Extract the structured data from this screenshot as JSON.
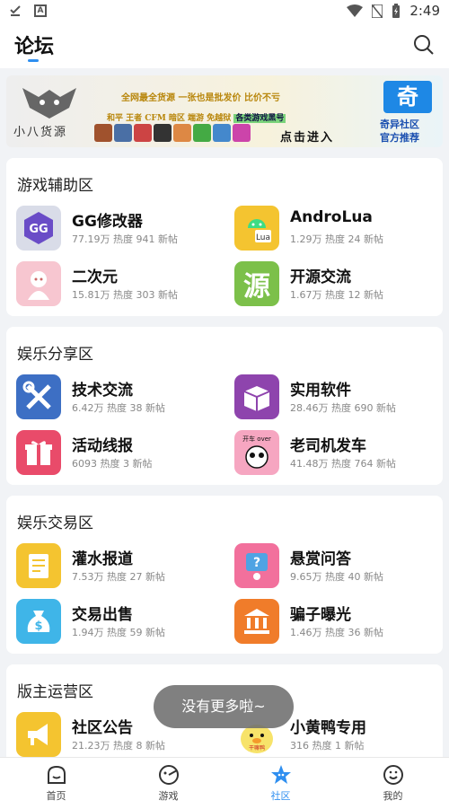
{
  "status_bar": {
    "time": "2:49"
  },
  "header": {
    "title": "论坛"
  },
  "banner": {
    "brand": "小八货源",
    "line1": "全网最全货源   一张也是批发价   比价不亏",
    "line2": "和平  王者  CFM  暗区  端游  免越狱",
    "tag": "各类游戏黑号",
    "cta": "点击进入",
    "logo_text": "奇",
    "community": "奇异社区",
    "recommend": "官方推荐"
  },
  "sections": [
    {
      "title": "游戏辅助区",
      "items": [
        {
          "name": "GG修改器",
          "stats": "77.19万 热度 941 新帖"
        },
        {
          "name": "AndroLua",
          "stats": "1.29万 热度 24 新帖"
        },
        {
          "name": "二次元",
          "stats": "15.81万 热度 303 新帖"
        },
        {
          "name": "开源交流",
          "stats": "1.67万 热度 12 新帖"
        }
      ]
    },
    {
      "title": "娱乐分享区",
      "items": [
        {
          "name": "技术交流",
          "stats": "6.42万 热度 38 新帖"
        },
        {
          "name": "实用软件",
          "stats": "28.46万 热度 690 新帖"
        },
        {
          "name": "活动线报",
          "stats": "6093 热度 3 新帖"
        },
        {
          "name": "老司机发车",
          "stats": "41.48万 热度 764 新帖"
        }
      ]
    },
    {
      "title": "娱乐交易区",
      "items": [
        {
          "name": "灌水报道",
          "stats": "7.53万 热度 27 新帖"
        },
        {
          "name": "悬赏问答",
          "stats": "9.65万 热度 40 新帖"
        },
        {
          "name": "交易出售",
          "stats": "1.94万 热度 59 新帖"
        },
        {
          "name": "骗子曝光",
          "stats": "1.46万 热度 36 新帖"
        }
      ]
    },
    {
      "title": "版主运营区",
      "items": [
        {
          "name": "社区公告",
          "stats": "21.23万 热度 8 新帖"
        },
        {
          "name": "小黄鸭专用",
          "stats": "316 热度 1 新帖"
        }
      ]
    }
  ],
  "icon_texts": {
    "gg": "GG",
    "lua": "Lua",
    "yuan": "源",
    "car": "开车 over",
    "duck": "干嘛鸭"
  },
  "toast": "没有更多啦~",
  "nav": [
    {
      "label": "首页",
      "icon": "home-face-icon"
    },
    {
      "label": "游戏",
      "icon": "game-icon"
    },
    {
      "label": "社区",
      "icon": "community-star-icon"
    },
    {
      "label": "我的",
      "icon": "profile-icon"
    }
  ],
  "colors": {
    "accent": "#2f8ff0",
    "background": "#f1f3f6"
  }
}
